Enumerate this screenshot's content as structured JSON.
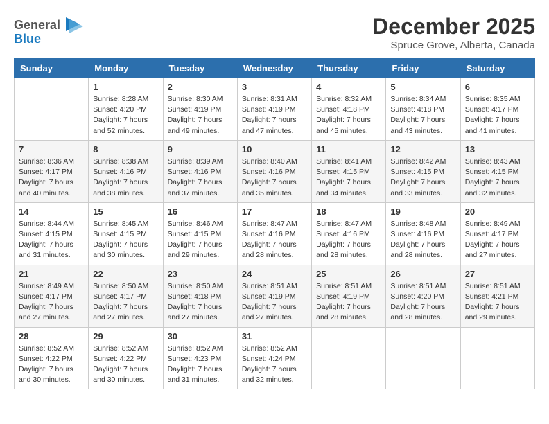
{
  "header": {
    "logo_line1": "General",
    "logo_line2": "Blue",
    "main_title": "December 2025",
    "subtitle": "Spruce Grove, Alberta, Canada"
  },
  "days_of_week": [
    "Sunday",
    "Monday",
    "Tuesday",
    "Wednesday",
    "Thursday",
    "Friday",
    "Saturday"
  ],
  "weeks": [
    [
      {
        "day": "",
        "sunrise": "",
        "sunset": "",
        "daylight": ""
      },
      {
        "day": "1",
        "sunrise": "Sunrise: 8:28 AM",
        "sunset": "Sunset: 4:20 PM",
        "daylight": "Daylight: 7 hours and 52 minutes."
      },
      {
        "day": "2",
        "sunrise": "Sunrise: 8:30 AM",
        "sunset": "Sunset: 4:19 PM",
        "daylight": "Daylight: 7 hours and 49 minutes."
      },
      {
        "day": "3",
        "sunrise": "Sunrise: 8:31 AM",
        "sunset": "Sunset: 4:19 PM",
        "daylight": "Daylight: 7 hours and 47 minutes."
      },
      {
        "day": "4",
        "sunrise": "Sunrise: 8:32 AM",
        "sunset": "Sunset: 4:18 PM",
        "daylight": "Daylight: 7 hours and 45 minutes."
      },
      {
        "day": "5",
        "sunrise": "Sunrise: 8:34 AM",
        "sunset": "Sunset: 4:18 PM",
        "daylight": "Daylight: 7 hours and 43 minutes."
      },
      {
        "day": "6",
        "sunrise": "Sunrise: 8:35 AM",
        "sunset": "Sunset: 4:17 PM",
        "daylight": "Daylight: 7 hours and 41 minutes."
      }
    ],
    [
      {
        "day": "7",
        "sunrise": "Sunrise: 8:36 AM",
        "sunset": "Sunset: 4:17 PM",
        "daylight": "Daylight: 7 hours and 40 minutes."
      },
      {
        "day": "8",
        "sunrise": "Sunrise: 8:38 AM",
        "sunset": "Sunset: 4:16 PM",
        "daylight": "Daylight: 7 hours and 38 minutes."
      },
      {
        "day": "9",
        "sunrise": "Sunrise: 8:39 AM",
        "sunset": "Sunset: 4:16 PM",
        "daylight": "Daylight: 7 hours and 37 minutes."
      },
      {
        "day": "10",
        "sunrise": "Sunrise: 8:40 AM",
        "sunset": "Sunset: 4:16 PM",
        "daylight": "Daylight: 7 hours and 35 minutes."
      },
      {
        "day": "11",
        "sunrise": "Sunrise: 8:41 AM",
        "sunset": "Sunset: 4:15 PM",
        "daylight": "Daylight: 7 hours and 34 minutes."
      },
      {
        "day": "12",
        "sunrise": "Sunrise: 8:42 AM",
        "sunset": "Sunset: 4:15 PM",
        "daylight": "Daylight: 7 hours and 33 minutes."
      },
      {
        "day": "13",
        "sunrise": "Sunrise: 8:43 AM",
        "sunset": "Sunset: 4:15 PM",
        "daylight": "Daylight: 7 hours and 32 minutes."
      }
    ],
    [
      {
        "day": "14",
        "sunrise": "Sunrise: 8:44 AM",
        "sunset": "Sunset: 4:15 PM",
        "daylight": "Daylight: 7 hours and 31 minutes."
      },
      {
        "day": "15",
        "sunrise": "Sunrise: 8:45 AM",
        "sunset": "Sunset: 4:15 PM",
        "daylight": "Daylight: 7 hours and 30 minutes."
      },
      {
        "day": "16",
        "sunrise": "Sunrise: 8:46 AM",
        "sunset": "Sunset: 4:15 PM",
        "daylight": "Daylight: 7 hours and 29 minutes."
      },
      {
        "day": "17",
        "sunrise": "Sunrise: 8:47 AM",
        "sunset": "Sunset: 4:16 PM",
        "daylight": "Daylight: 7 hours and 28 minutes."
      },
      {
        "day": "18",
        "sunrise": "Sunrise: 8:47 AM",
        "sunset": "Sunset: 4:16 PM",
        "daylight": "Daylight: 7 hours and 28 minutes."
      },
      {
        "day": "19",
        "sunrise": "Sunrise: 8:48 AM",
        "sunset": "Sunset: 4:16 PM",
        "daylight": "Daylight: 7 hours and 28 minutes."
      },
      {
        "day": "20",
        "sunrise": "Sunrise: 8:49 AM",
        "sunset": "Sunset: 4:17 PM",
        "daylight": "Daylight: 7 hours and 27 minutes."
      }
    ],
    [
      {
        "day": "21",
        "sunrise": "Sunrise: 8:49 AM",
        "sunset": "Sunset: 4:17 PM",
        "daylight": "Daylight: 7 hours and 27 minutes."
      },
      {
        "day": "22",
        "sunrise": "Sunrise: 8:50 AM",
        "sunset": "Sunset: 4:17 PM",
        "daylight": "Daylight: 7 hours and 27 minutes."
      },
      {
        "day": "23",
        "sunrise": "Sunrise: 8:50 AM",
        "sunset": "Sunset: 4:18 PM",
        "daylight": "Daylight: 7 hours and 27 minutes."
      },
      {
        "day": "24",
        "sunrise": "Sunrise: 8:51 AM",
        "sunset": "Sunset: 4:19 PM",
        "daylight": "Daylight: 7 hours and 27 minutes."
      },
      {
        "day": "25",
        "sunrise": "Sunrise: 8:51 AM",
        "sunset": "Sunset: 4:19 PM",
        "daylight": "Daylight: 7 hours and 28 minutes."
      },
      {
        "day": "26",
        "sunrise": "Sunrise: 8:51 AM",
        "sunset": "Sunset: 4:20 PM",
        "daylight": "Daylight: 7 hours and 28 minutes."
      },
      {
        "day": "27",
        "sunrise": "Sunrise: 8:51 AM",
        "sunset": "Sunset: 4:21 PM",
        "daylight": "Daylight: 7 hours and 29 minutes."
      }
    ],
    [
      {
        "day": "28",
        "sunrise": "Sunrise: 8:52 AM",
        "sunset": "Sunset: 4:22 PM",
        "daylight": "Daylight: 7 hours and 30 minutes."
      },
      {
        "day": "29",
        "sunrise": "Sunrise: 8:52 AM",
        "sunset": "Sunset: 4:22 PM",
        "daylight": "Daylight: 7 hours and 30 minutes."
      },
      {
        "day": "30",
        "sunrise": "Sunrise: 8:52 AM",
        "sunset": "Sunset: 4:23 PM",
        "daylight": "Daylight: 7 hours and 31 minutes."
      },
      {
        "day": "31",
        "sunrise": "Sunrise: 8:52 AM",
        "sunset": "Sunset: 4:24 PM",
        "daylight": "Daylight: 7 hours and 32 minutes."
      },
      {
        "day": "",
        "sunrise": "",
        "sunset": "",
        "daylight": ""
      },
      {
        "day": "",
        "sunrise": "",
        "sunset": "",
        "daylight": ""
      },
      {
        "day": "",
        "sunrise": "",
        "sunset": "",
        "daylight": ""
      }
    ]
  ]
}
